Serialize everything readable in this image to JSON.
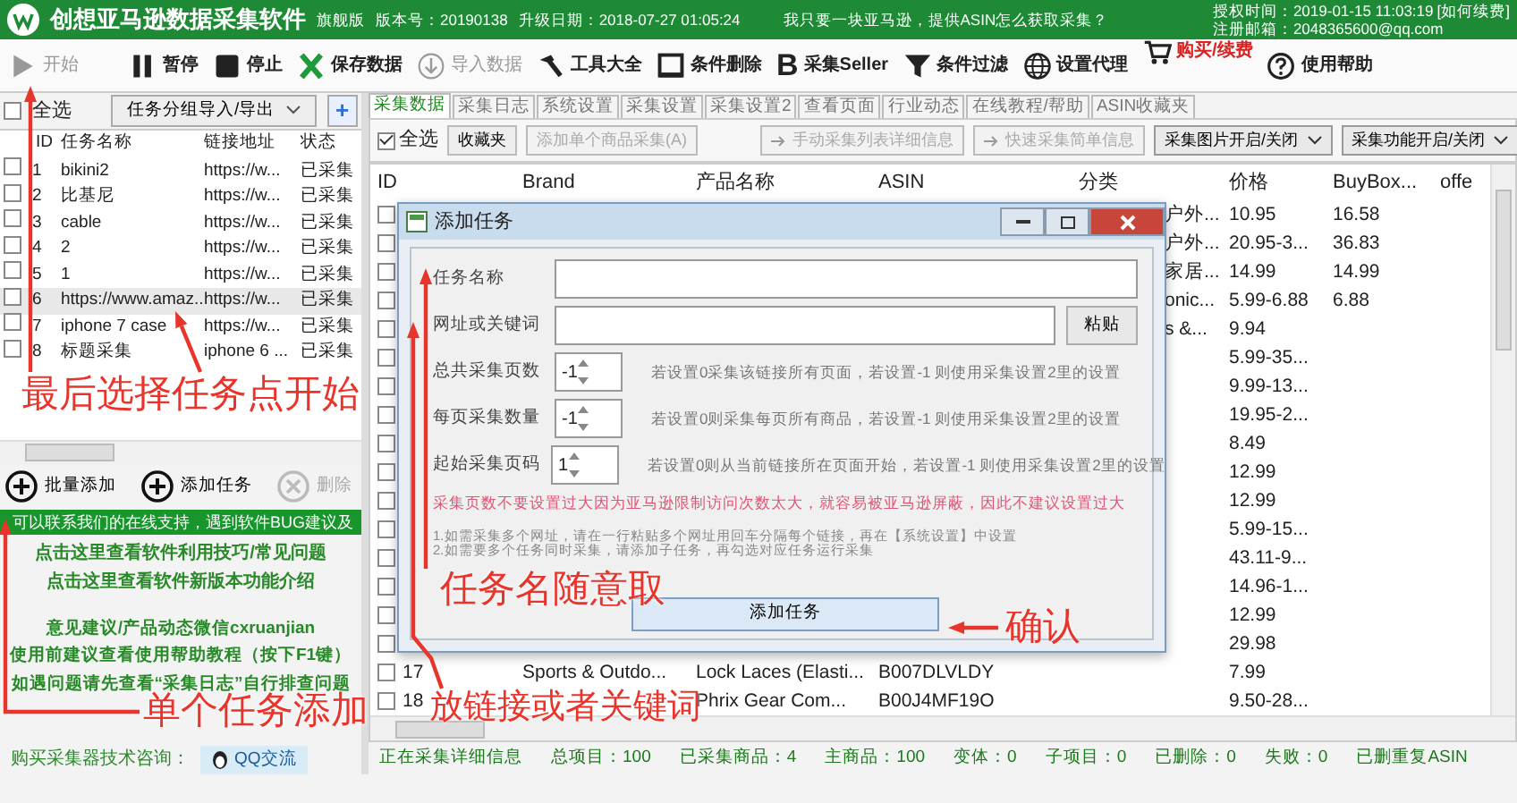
{
  "app": {
    "title": "创想亚马逊数据采集软件",
    "edition": "旗舰版",
    "version": "版本号：20190138",
    "update": "升级日期：2018-07-27 01:05:24",
    "notice": "我只要一块亚马逊，提供ASIN怎么获取采集？",
    "license": "授权时间：2019-01-15 11:03:19",
    "renew_link": "[如何续费]",
    "email": "注册邮箱：2048365600@qq.com"
  },
  "toolbar": [
    {
      "label": "开始",
      "disabled": true
    },
    {
      "label": "暂停",
      "disabled": false
    },
    {
      "label": "停止",
      "disabled": false
    },
    {
      "label": "保存数据",
      "disabled": false
    },
    {
      "label": "导入数据",
      "disabled": true
    },
    {
      "label": "工具大全",
      "disabled": false
    },
    {
      "label": "条件删除",
      "disabled": false
    },
    {
      "label": "采集Seller",
      "disabled": false,
      "glyph": "B"
    },
    {
      "label": "条件过滤",
      "disabled": false
    },
    {
      "label": "设置代理",
      "disabled": false
    },
    {
      "label": "购买/续费",
      "disabled": false,
      "kind": "alert"
    },
    {
      "label": "使用帮助",
      "disabled": false
    }
  ],
  "task_panel": {
    "select_all": {
      "label": "全选",
      "checked": false
    },
    "group_menu": "任务分组导入/导出",
    "add_button": "+",
    "columns": [
      "ID",
      "任务名称",
      "链接地址",
      "状态"
    ],
    "rows": [
      {
        "id": "1",
        "name": "bikini2",
        "url": "https://w...",
        "status": "已采集",
        "checked": false,
        "selected": false
      },
      {
        "id": "2",
        "name": "比基尼",
        "url": "https://w...",
        "status": "已采集",
        "checked": false,
        "selected": false
      },
      {
        "id": "3",
        "name": "cable",
        "url": "https://w...",
        "status": "已采集",
        "checked": false,
        "selected": false
      },
      {
        "id": "4",
        "name": "2",
        "url": "https://w...",
        "status": "已采集",
        "checked": false,
        "selected": false
      },
      {
        "id": "5",
        "name": "1",
        "url": "https://w...",
        "status": "已采集",
        "checked": false,
        "selected": false
      },
      {
        "id": "6",
        "name": "https://www.amaz...",
        "url": "https://w...",
        "status": "已采集",
        "checked": false,
        "selected": true
      },
      {
        "id": "7",
        "name": "iphone 7 case",
        "url": "https://w...",
        "status": "已采集",
        "checked": false,
        "selected": false
      },
      {
        "id": "8",
        "name": "标题采集",
        "url": "iphone 6 ...",
        "status": "已采集",
        "checked": false,
        "selected": false
      }
    ],
    "actions": [
      {
        "label": "批量添加",
        "disabled": false,
        "kind": "add"
      },
      {
        "label": "添加任务",
        "disabled": false,
        "kind": "add"
      },
      {
        "label": "删除",
        "disabled": true,
        "kind": "delete"
      }
    ]
  },
  "support": {
    "marquee": "可以联系我们的在线支持，遇到软件BUG建议及",
    "links": [
      "点击这里查看软件利用技巧/常见问题",
      "点击这里查看软件新版本功能介绍"
    ],
    "lines": [
      "意见建议/产品动态微信cxruanjian",
      "使用前建议查看使用帮助教程（按下F1键）",
      "如遇问题请先查看“采集日志”自行排查问题"
    ],
    "consult_label": "购买采集器技术咨询：",
    "qq_button": "QQ交流"
  },
  "tabs": [
    {
      "label": "采集数据",
      "selected": true
    },
    {
      "label": "采集日志",
      "selected": false
    },
    {
      "label": "系统设置",
      "selected": false
    },
    {
      "label": "采集设置",
      "selected": false
    },
    {
      "label": "采集设置2",
      "selected": false
    },
    {
      "label": "查看页面",
      "selected": false
    },
    {
      "label": "行业动态",
      "selected": false
    },
    {
      "label": "在线教程/帮助",
      "selected": false
    },
    {
      "label": "ASIN收藏夹",
      "selected": false
    }
  ],
  "data_toolbar": {
    "select_all": {
      "label": "全选",
      "checked": true
    },
    "buttons": [
      {
        "label": "收藏夹",
        "disabled": false,
        "kind": "plain"
      },
      {
        "label": "添加单个商品采集(A)",
        "disabled": true,
        "kind": "plain"
      },
      {
        "label": "手动采集列表详细信息",
        "disabled": true,
        "kind": "arrow"
      },
      {
        "label": "快速采集简单信息",
        "disabled": true,
        "kind": "arrow"
      }
    ],
    "dropdowns": [
      "采集图片开启/关闭",
      "采集功能开启/关闭"
    ]
  },
  "grid": {
    "columns": [
      "ID",
      "Brand",
      "产品名称",
      "ASIN",
      "分类",
      "价格",
      "BuyBox...",
      "offe"
    ],
    "rows": [
      {
        "category": "户外...",
        "price": "10.95",
        "buybox": "16.58",
        "checked": false
      },
      {
        "category": "户外...",
        "price": "20.95-3...",
        "buybox": "36.83",
        "checked": false
      },
      {
        "category": "家居...",
        "price": "14.99",
        "buybox": "14.99",
        "checked": false
      },
      {
        "category": "onic...",
        "price": "5.99-6.88",
        "buybox": "6.88",
        "checked": false
      },
      {
        "category": "s &...",
        "price": "9.94",
        "checked": false
      },
      {
        "price": "5.99-35...",
        "checked": false
      },
      {
        "price": "9.99-13...",
        "checked": false
      },
      {
        "price": "19.95-2...",
        "checked": false
      },
      {
        "price": "8.49",
        "checked": false
      },
      {
        "price": "12.99",
        "checked": false
      },
      {
        "price": "12.99",
        "checked": false
      },
      {
        "price": "5.99-15...",
        "checked": false
      },
      {
        "price": "43.11-9...",
        "checked": false
      },
      {
        "price": "14.96-1...",
        "checked": false
      },
      {
        "price": "12.99",
        "checked": false
      },
      {
        "price": "29.98",
        "checked": false
      },
      {
        "id": "17",
        "brand": "Sports & Outdo...",
        "name": "Lock Laces (Elasti...",
        "asin": "B007DLVLDY",
        "price": "7.99",
        "checked": false
      },
      {
        "id": "18",
        "name": "Phrix Gear Com...",
        "asin": "B00J4MF19O",
        "price": "9.50-28...",
        "checked": false
      }
    ]
  },
  "dialog": {
    "title": "添加任务",
    "fields": [
      {
        "kind": "text",
        "label": "任务名称"
      },
      {
        "kind": "text_button",
        "label": "网址或关键词",
        "button": "粘贴"
      },
      {
        "kind": "spin",
        "label": "总共采集页数",
        "value": "-1",
        "hint": "若设置0采集该链接所有页面，若设置-1 则使用采集设置2里的设置"
      },
      {
        "kind": "spin",
        "label": "每页采集数量",
        "value": "-1",
        "hint": "若设置0则采集每页所有商品，若设置-1 则使用采集设置2里的设置"
      },
      {
        "kind": "spin",
        "label": "起始采集页码",
        "value": "1",
        "hint": "若设置0则从当前链接所在页面开始，若设置-1 则使用采集设置2里的设置"
      }
    ],
    "warning": "采集页数不要设置过大因为亚马逊限制访问次数太大，就容易被亚马逊屏蔽，因此不建议设置过大",
    "notes": [
      "1.如需采集多个网址，请在一行粘贴多个网址用回车分隔每个链接，再在【系统设置】中设置",
      "2.如需要多个任务同时采集，请添加子任务，再勾选对应任务运行采集"
    ],
    "submit": "添加任务"
  },
  "status_bar": [
    "正在采集详细信息",
    "总项目：100",
    "已采集商品：4",
    "主商品：100",
    "变体：0",
    "子项目：0",
    "已删除：0",
    "失败：0",
    "已删重复ASIN"
  ],
  "annotations": [
    "最后选择任务点开始",
    "任务名随意取",
    "单个任务添加",
    "放链接或者关键词",
    "确认"
  ]
}
